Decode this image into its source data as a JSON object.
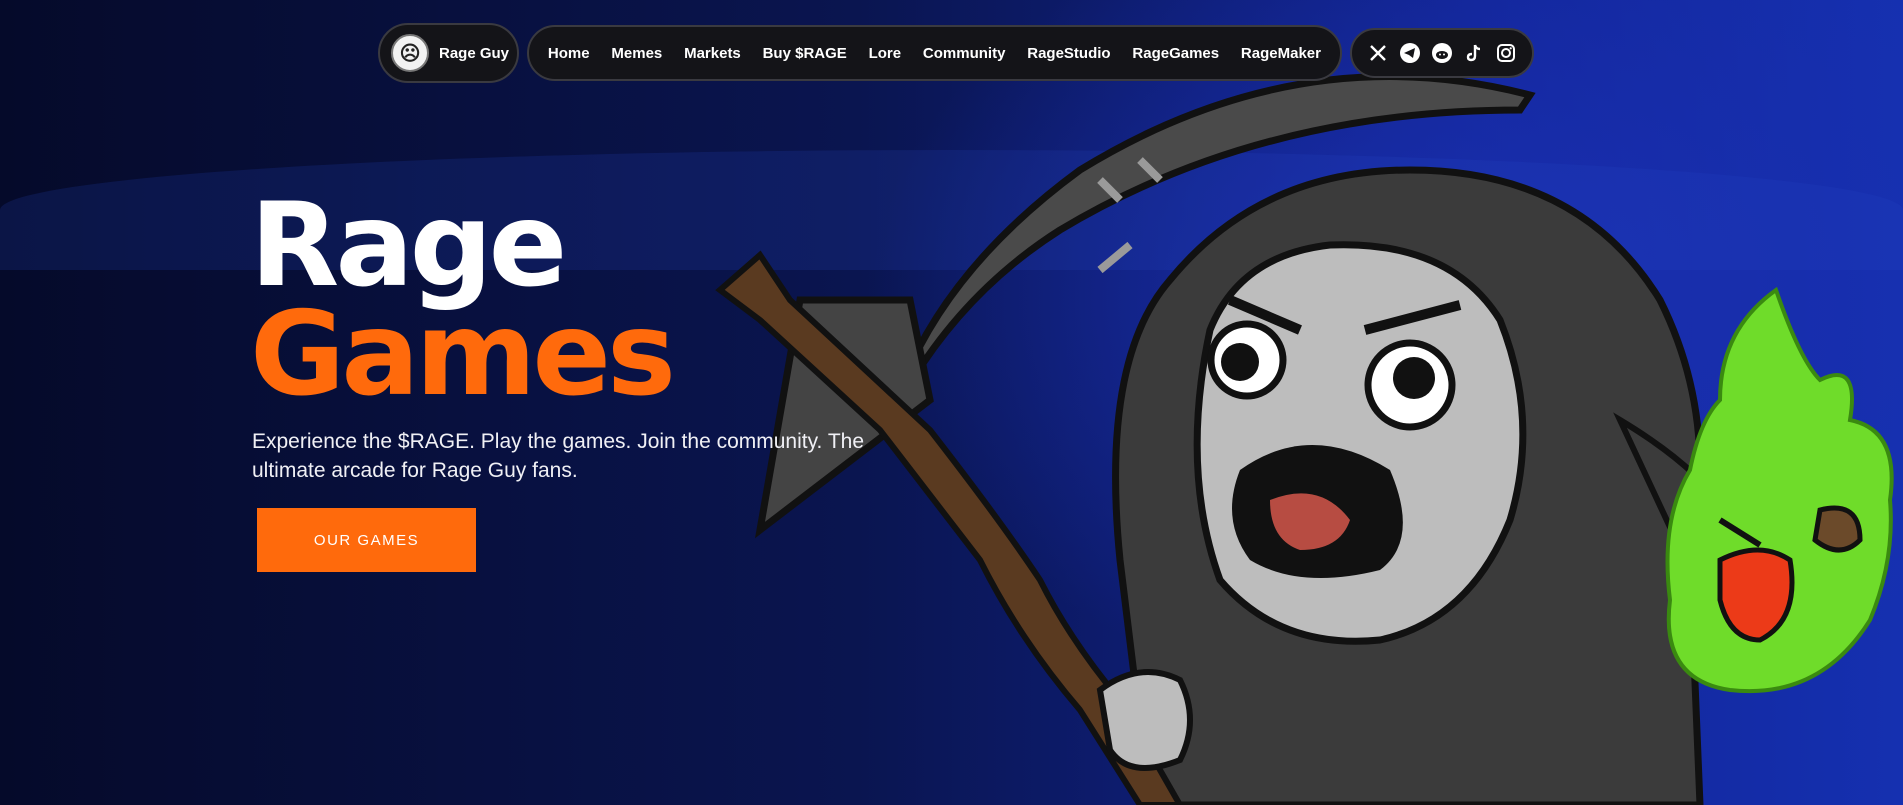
{
  "brand": {
    "name": "Rage Guy",
    "avatar_icon": "rage-face-icon"
  },
  "nav": {
    "links": [
      "Home",
      "Memes",
      "Markets",
      "Buy $RAGE",
      "Lore",
      "Community",
      "RageStudio",
      "RageGames",
      "RageMaker"
    ]
  },
  "social": [
    "x-icon",
    "telegram-icon",
    "reddit-icon",
    "tiktok-icon",
    "instagram-icon"
  ],
  "hero": {
    "title_line1": "Rage",
    "title_line2": "Games",
    "tagline": "Experience the $RAGE. Play the games. Join the community. The ultimate arcade for Rage Guy fans.",
    "cta_label": "OUR GAMES"
  },
  "colors": {
    "accent": "#ff6a0c",
    "background": "#07103a",
    "nav_bg": "#141418",
    "ghost_green": "#6fdc2a"
  }
}
